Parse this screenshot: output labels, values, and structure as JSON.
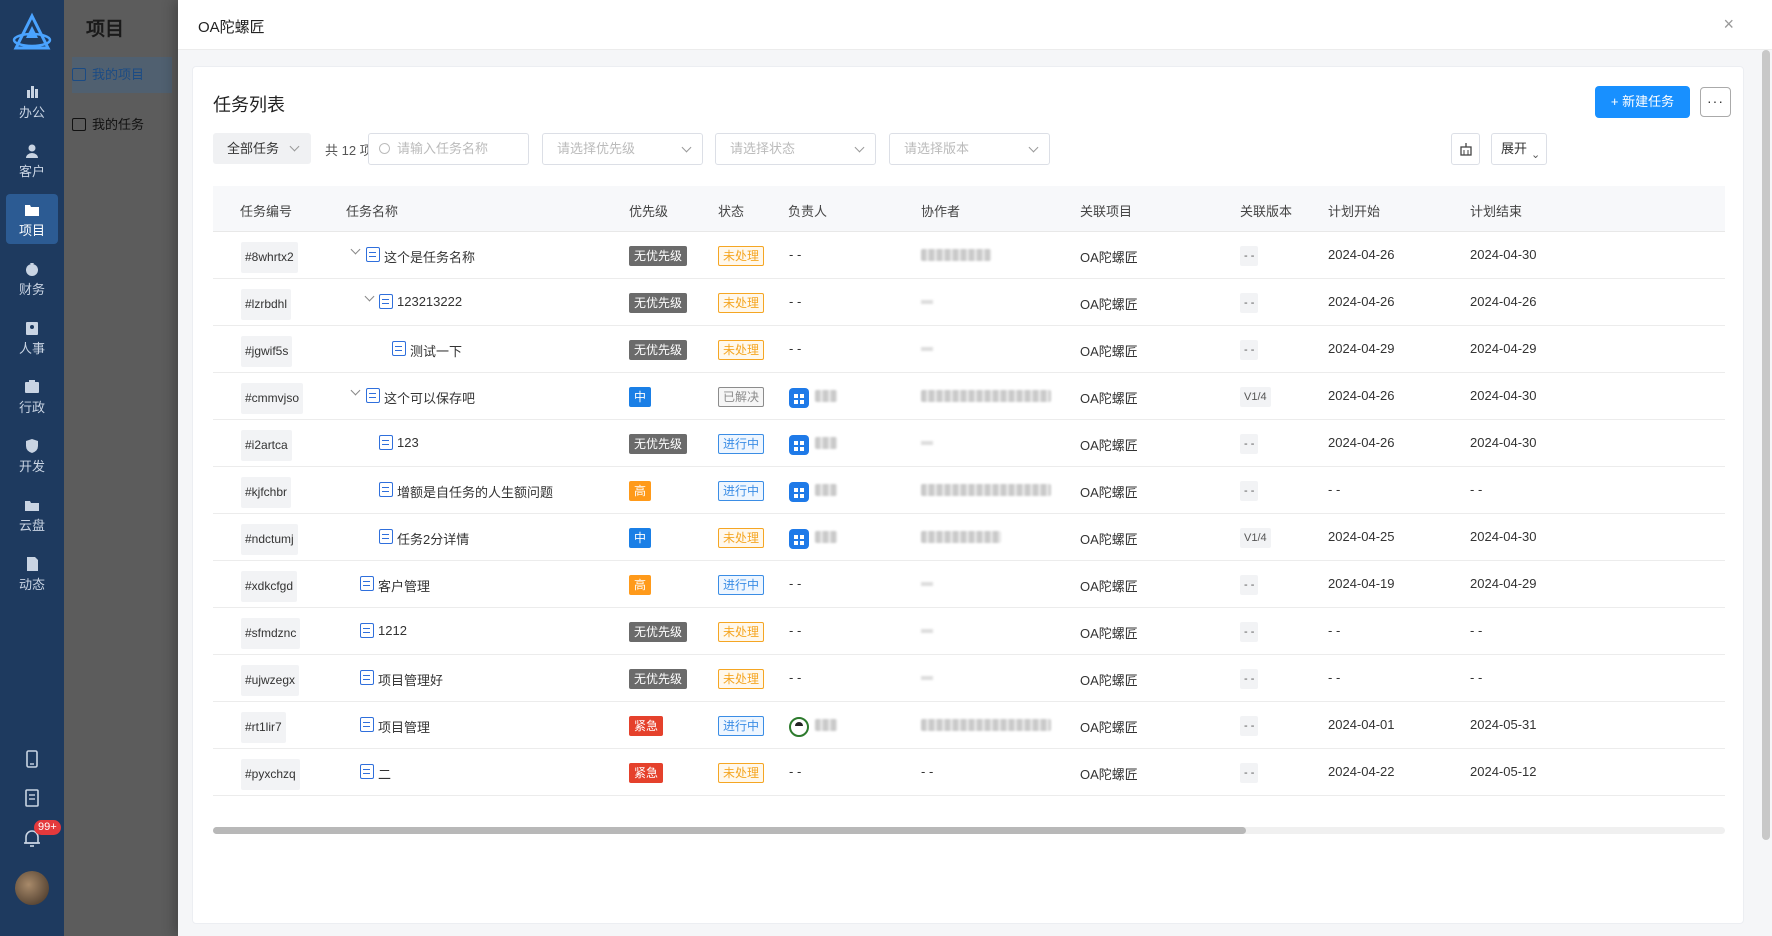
{
  "nav": {
    "items": [
      {
        "label": "办公",
        "icon": "office-icon"
      },
      {
        "label": "客户",
        "icon": "customer-icon"
      },
      {
        "label": "项目",
        "icon": "project-folder-icon",
        "active": true
      },
      {
        "label": "财务",
        "icon": "finance-icon"
      },
      {
        "label": "人事",
        "icon": "hr-icon"
      },
      {
        "label": "行政",
        "icon": "admin-icon"
      },
      {
        "label": "开发",
        "icon": "dev-shield-icon"
      },
      {
        "label": "云盘",
        "icon": "cloud-disk-icon"
      },
      {
        "label": "动态",
        "icon": "activity-icon"
      }
    ],
    "notification_badge": "99+"
  },
  "subnav": {
    "title": "项目",
    "items": [
      {
        "label": "我的项目",
        "active": true
      },
      {
        "label": "我的任务",
        "active": false
      }
    ]
  },
  "drawer": {
    "title": "OA陀螺匠",
    "close": "×"
  },
  "toolbar": {
    "card_title": "任务列表",
    "new_task": "+ 新建任务",
    "more": "···",
    "filter_all": "全部任务",
    "total": "共 12 项",
    "search_placeholder": "请输入任务名称",
    "priority_placeholder": "请选择优先级",
    "status_placeholder": "请选择状态",
    "version_placeholder": "请选择版本",
    "expand": "展开"
  },
  "table": {
    "columns": [
      "任务编号",
      "任务名称",
      "优先级",
      "状态",
      "负责人",
      "协作者",
      "关联项目",
      "关联版本",
      "计划开始",
      "计划结束"
    ],
    "rows": [
      {
        "code": "#8whrtx2",
        "name": "这个是任务名称",
        "level": 0,
        "expand": true,
        "priority": "无优先级",
        "status": "未处理",
        "owner": "- -",
        "version": "- -",
        "start": "2024-04-26",
        "end": "2024-04-30",
        "project": "OA陀螺匠"
      },
      {
        "code": "#lzrbdhl",
        "name": "123213222",
        "level": 1,
        "expand": true,
        "priority": "无优先级",
        "status": "未处理",
        "owner": "- -",
        "version": "- -",
        "start": "2024-04-26",
        "end": "2024-04-26",
        "project": "OA陀螺匠"
      },
      {
        "code": "#jgwif5s",
        "name": "测试一下",
        "level": 2,
        "expand": false,
        "priority": "无优先级",
        "status": "未处理",
        "owner": "- -",
        "version": "- -",
        "start": "2024-04-29",
        "end": "2024-04-29",
        "project": "OA陀螺匠"
      },
      {
        "code": "#cmmvjso",
        "name": "这个可以保存吧",
        "level": 0,
        "expand": true,
        "priority": "中",
        "status": "已解决",
        "owner": "",
        "version": "V1/4",
        "start": "2024-04-26",
        "end": "2024-04-30",
        "project": "OA陀螺匠"
      },
      {
        "code": "#i2artca",
        "name": "123",
        "level": 1,
        "expand": false,
        "priority": "无优先级",
        "status": "进行中",
        "owner": "",
        "version": "- -",
        "start": "2024-04-26",
        "end": "2024-04-30",
        "project": "OA陀螺匠"
      },
      {
        "code": "#kjfchbr",
        "name": "增额是自任务的人生额问题",
        "level": 1,
        "expand": false,
        "priority": "高",
        "status": "进行中",
        "owner": "",
        "version": "- -",
        "start": "- -",
        "end": "- -",
        "project": "OA陀螺匠"
      },
      {
        "code": "#ndctumj",
        "name": "任务2分详情",
        "level": 1,
        "expand": false,
        "priority": "中",
        "status": "未处理",
        "owner": "",
        "version": "V1/4",
        "start": "2024-04-25",
        "end": "2024-04-30",
        "project": "OA陀螺匠"
      },
      {
        "code": "#xdkcfgd",
        "name": "客户管理",
        "level": 0.5,
        "expand": false,
        "priority": "高",
        "status": "进行中",
        "owner": "- -",
        "version": "- -",
        "start": "2024-04-19",
        "end": "2024-04-29",
        "project": "OA陀螺匠"
      },
      {
        "code": "#sfmdznc",
        "name": "1212",
        "level": 0.5,
        "expand": false,
        "priority": "无优先级",
        "status": "未处理",
        "owner": "- -",
        "version": "- -",
        "start": "- -",
        "end": "- -",
        "project": "OA陀螺匠"
      },
      {
        "code": "#ujwzegx",
        "name": "项目管理好",
        "level": 0.5,
        "expand": false,
        "priority": "无优先级",
        "status": "未处理",
        "owner": "- -",
        "version": "- -",
        "start": "- -",
        "end": "- -",
        "project": "OA陀螺匠"
      },
      {
        "code": "#rt1lir7",
        "name": "项目管理",
        "level": 0.5,
        "expand": false,
        "priority": "紧急",
        "status": "进行中",
        "owner": "",
        "version": "- -",
        "start": "2024-04-01",
        "end": "2024-05-31",
        "project": "OA陀螺匠"
      },
      {
        "code": "#pyxchzq",
        "name": "二",
        "level": 0.5,
        "expand": false,
        "priority": "紧急",
        "status": "未处理",
        "owner": "- -",
        "collab": "- -",
        "version": "- -",
        "start": "2024-04-22",
        "end": "2024-05-12",
        "project": "OA陀螺匠"
      }
    ]
  },
  "colors": {
    "primary": "#1890ff",
    "nav_bg": "#1e3a5f",
    "priority_none": "#6b6b6b",
    "priority_mid": "#1a7fe6",
    "priority_high": "#ff9a1a",
    "priority_urgent": "#e5412c",
    "status_todo": "#f5a623",
    "status_doing": "#3b8de5",
    "status_done": "#8c8c8c"
  }
}
